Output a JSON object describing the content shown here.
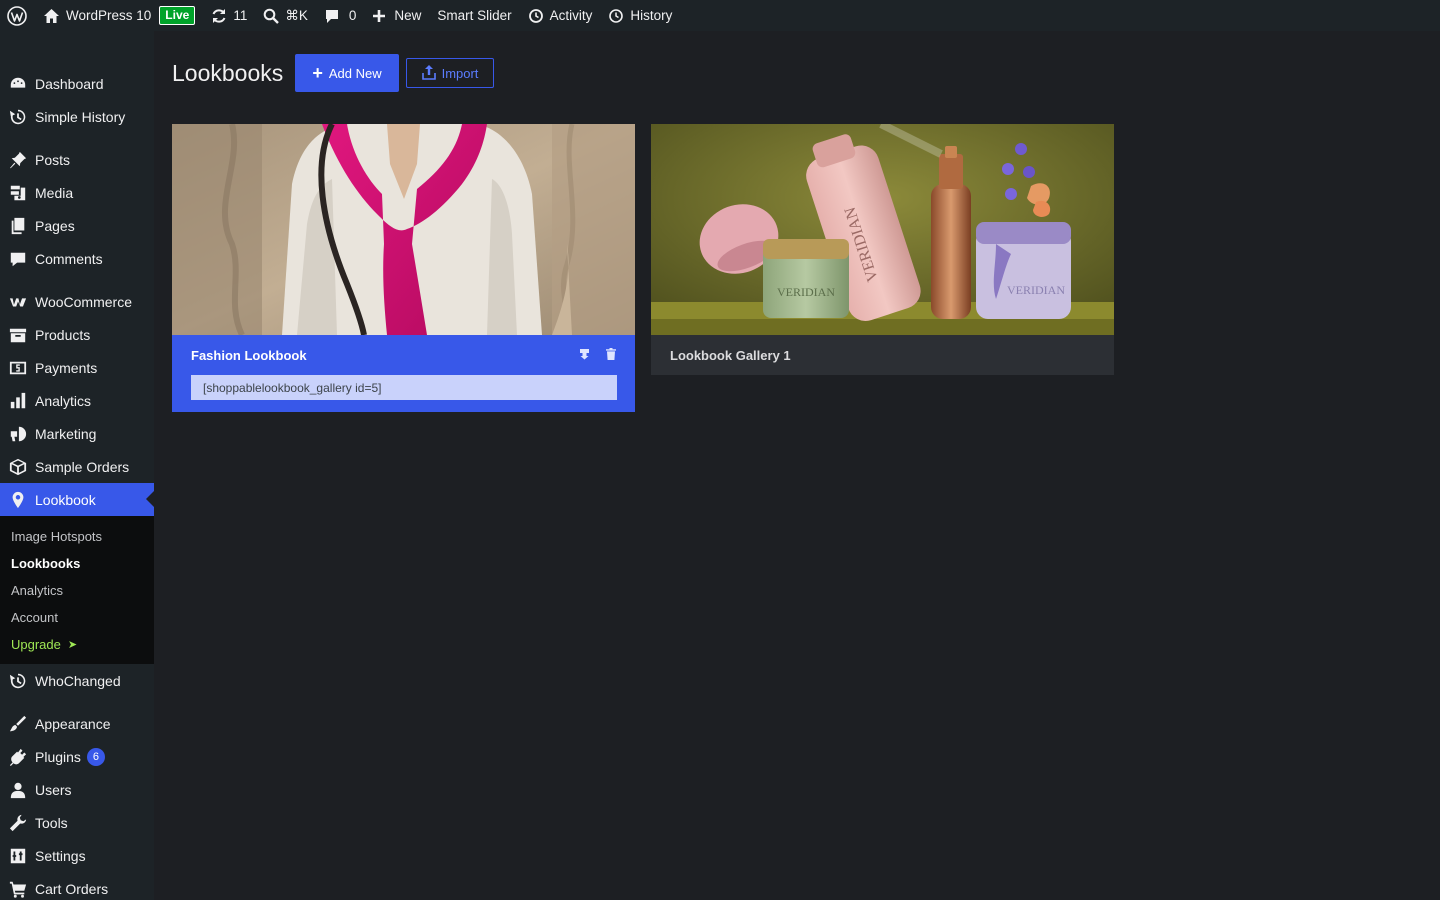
{
  "adminbar": {
    "site_name": "WordPress 10",
    "live_label": "Live",
    "updates_count": "11",
    "search_shortcut": "⌘K",
    "comments_count": "0",
    "new_label": "New",
    "smart_slider_label": "Smart Slider",
    "activity_label": "Activity",
    "history_label": "History"
  },
  "sidebar": {
    "items": [
      {
        "label": "Dashboard",
        "icon": "dashboard-icon"
      },
      {
        "label": "Simple History",
        "icon": "history-icon"
      },
      {
        "label": "Posts",
        "icon": "pin-icon"
      },
      {
        "label": "Media",
        "icon": "media-icon"
      },
      {
        "label": "Pages",
        "icon": "pages-icon"
      },
      {
        "label": "Comments",
        "icon": "comment-icon"
      },
      {
        "label": "WooCommerce",
        "icon": "woo-icon"
      },
      {
        "label": "Products",
        "icon": "archive-icon"
      },
      {
        "label": "Payments",
        "icon": "payments-icon"
      },
      {
        "label": "Analytics",
        "icon": "chart-bar-icon"
      },
      {
        "label": "Marketing",
        "icon": "megaphone-icon"
      },
      {
        "label": "Sample Orders",
        "icon": "box-icon"
      },
      {
        "label": "Lookbook",
        "icon": "location-pin-icon"
      }
    ],
    "submenu": [
      {
        "label": "Image Hotspots"
      },
      {
        "label": "Lookbooks"
      },
      {
        "label": "Analytics"
      },
      {
        "label": "Account"
      },
      {
        "label": "Upgrade",
        "suffix": "➤"
      }
    ],
    "items_after": [
      {
        "label": "WhoChanged",
        "icon": "history-icon"
      },
      {
        "label": "Appearance",
        "icon": "brush-icon"
      },
      {
        "label": "Plugins",
        "icon": "plugin-icon",
        "badge": "6"
      },
      {
        "label": "Users",
        "icon": "user-icon"
      },
      {
        "label": "Tools",
        "icon": "wrench-icon"
      },
      {
        "label": "Settings",
        "icon": "settings-icon"
      },
      {
        "label": "Cart Orders",
        "icon": "cart-icon"
      }
    ]
  },
  "main": {
    "title": "Lookbooks",
    "add_new_label": "Add New",
    "import_label": "Import",
    "cards": [
      {
        "title": "Fashion Lookbook",
        "shortcode": "[shoppablelookbook_gallery id=5]"
      },
      {
        "title": "Lookbook Gallery 1"
      }
    ]
  },
  "colors": {
    "accent": "#3858e9",
    "sidebar_bg": "#1d2327",
    "page_bg": "#1d1f23",
    "upgrade": "#9fe855"
  }
}
